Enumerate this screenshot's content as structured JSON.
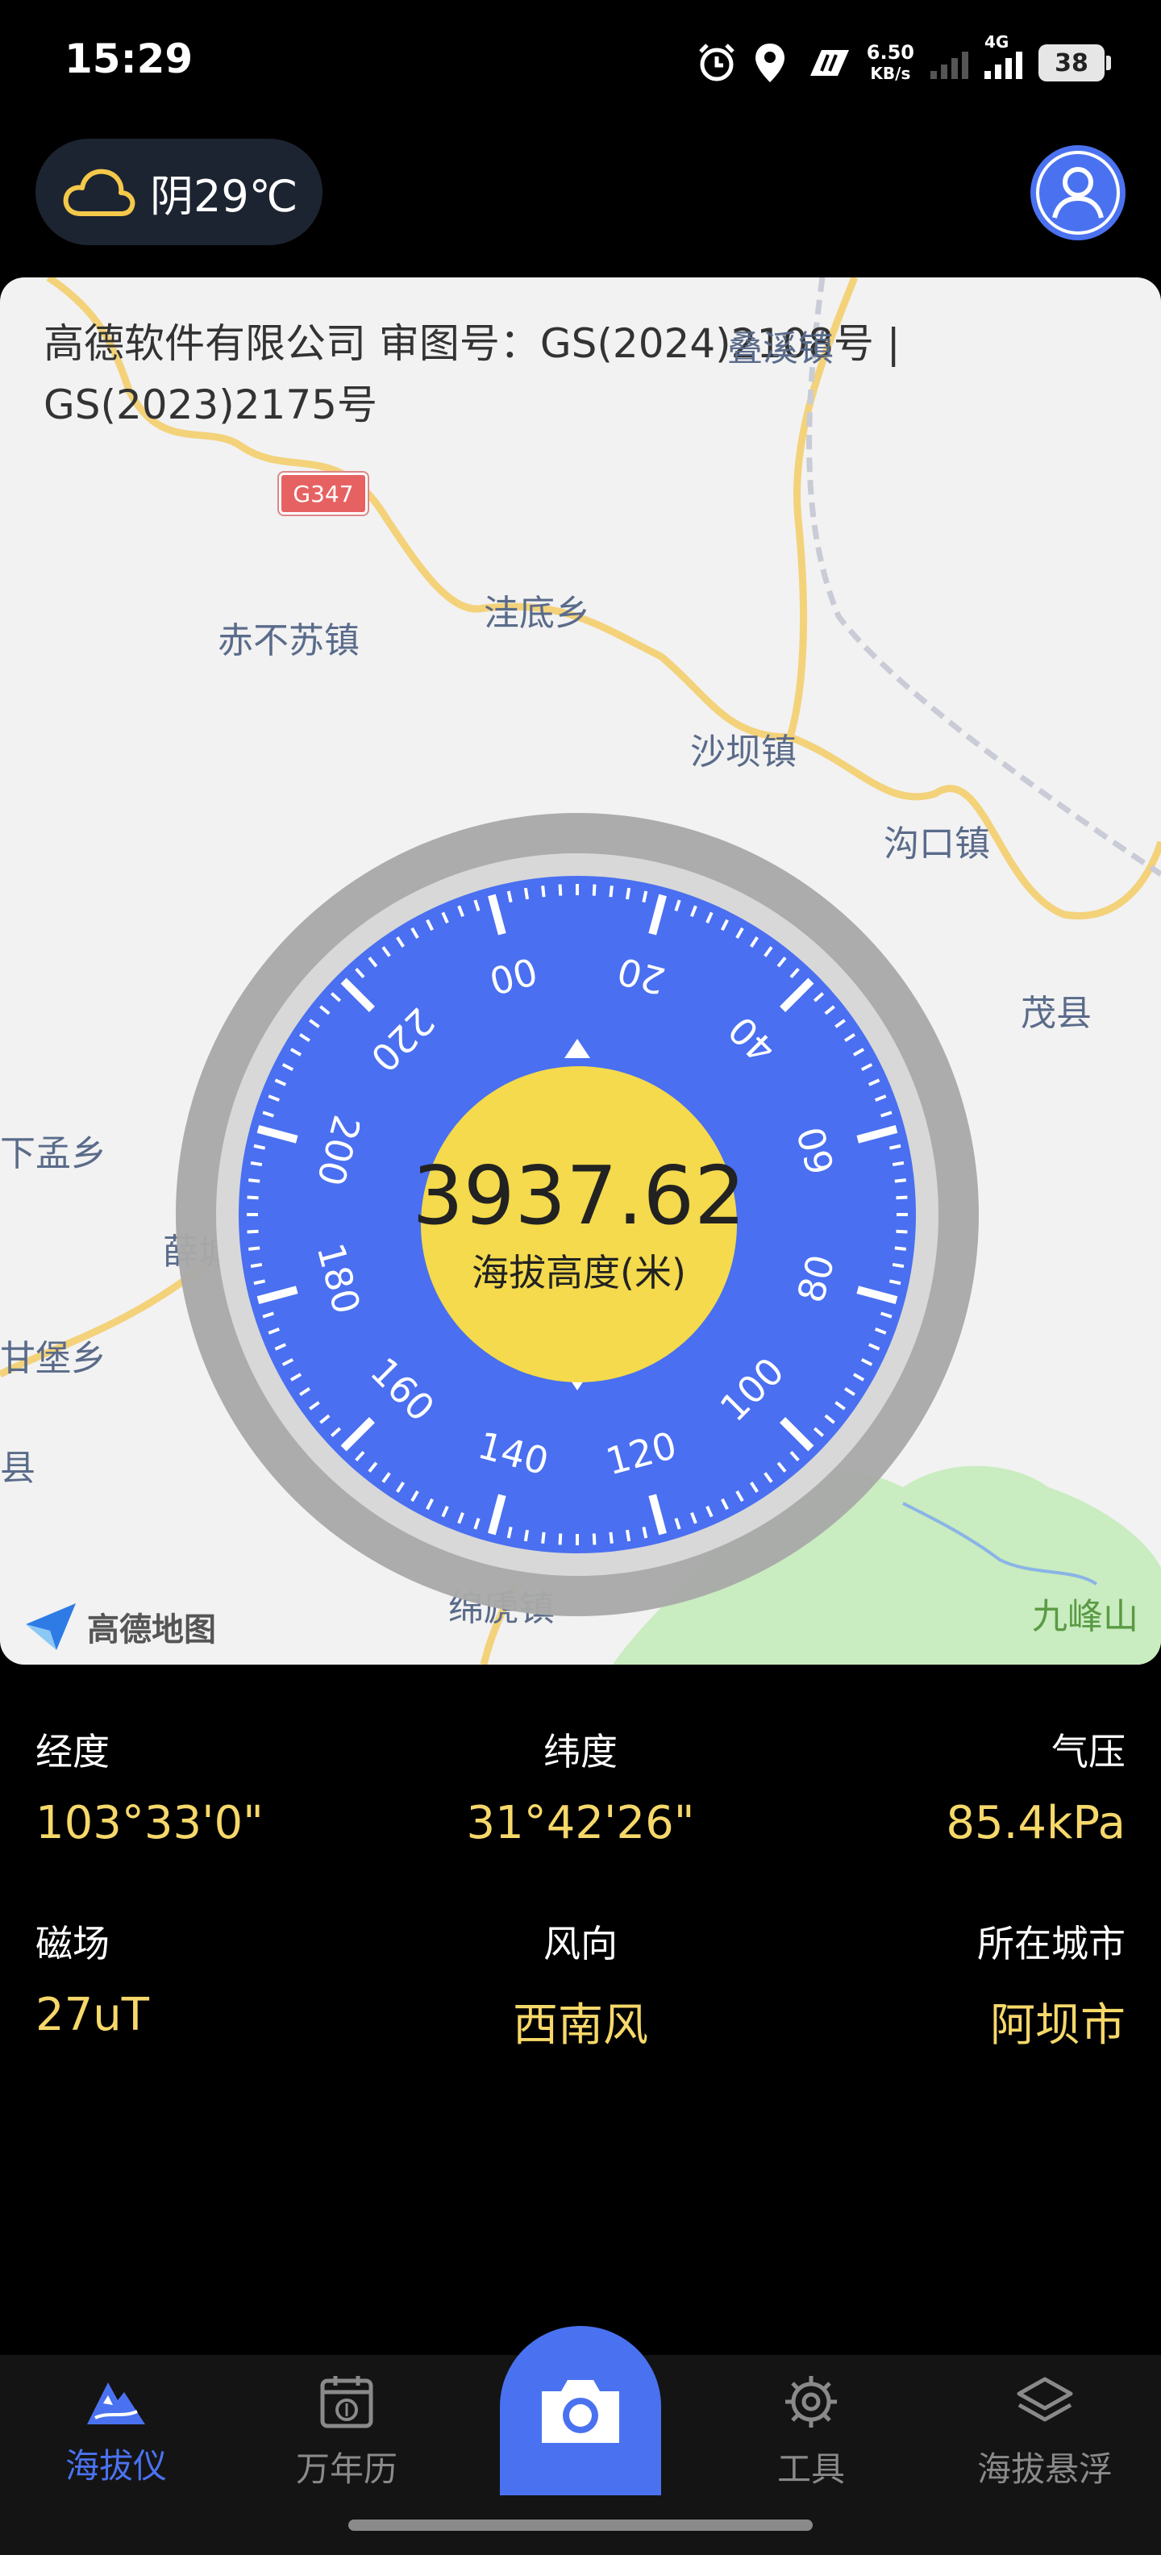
{
  "status_bar": {
    "time": "15:29",
    "net_speed_value": "6.50",
    "net_speed_unit": "KB/s",
    "network_type": "4G",
    "battery_level": "38",
    "icons": [
      "alarm-icon",
      "location-icon",
      "nfc-icon",
      "signal-icon",
      "battery-icon"
    ]
  },
  "header": {
    "weather_text": "阴29℃",
    "weather_icon": "cloud-icon",
    "avatar_icon": "user-icon"
  },
  "map": {
    "copyright": "高德软件有限公司 审图号：GS(2024)2108号 | GS(2023)2175号",
    "road_sign": "G347",
    "places": [
      "叠溪镇",
      "洼底乡",
      "赤不苏镇",
      "沙坝镇",
      "沟口镇",
      "茂县",
      "下孟乡",
      "薛城",
      "甘堡乡",
      "县",
      "九峰山",
      "绵虒镇",
      "镇"
    ],
    "logo_text": "高德地图"
  },
  "dial": {
    "altitude": "3937.62",
    "altitude_label": "海拔高度(米)",
    "scale_labels": [
      "00",
      "20",
      "40",
      "60",
      "80",
      "100",
      "120",
      "140",
      "160",
      "180",
      "200",
      "220"
    ],
    "colors": {
      "face": "#4a6ff0",
      "center": "#f4da4c",
      "ring": "#a9a9a9"
    }
  },
  "info": {
    "longitude_label": "经度",
    "longitude_value": "103°33'0\"",
    "latitude_label": "纬度",
    "latitude_value": "31°42'26\"",
    "pressure_label": "气压",
    "pressure_value": "85.4kPa",
    "magnetic_label": "磁场",
    "magnetic_value": "27uT",
    "wind_label": "风向",
    "wind_value": "西南风",
    "city_label": "所在城市",
    "city_value": "阿坝市"
  },
  "bottom_nav": {
    "items": [
      {
        "label": "海拔仪",
        "icon": "mountain-icon",
        "active": true
      },
      {
        "label": "万年历",
        "icon": "calendar-icon",
        "active": false
      },
      {
        "label": "",
        "icon": "camera-icon",
        "active": false
      },
      {
        "label": "工具",
        "icon": "tools-icon",
        "active": false
      },
      {
        "label": "海拔悬浮",
        "icon": "layers-icon",
        "active": false
      }
    ],
    "accent_color": "#4a72f0"
  }
}
